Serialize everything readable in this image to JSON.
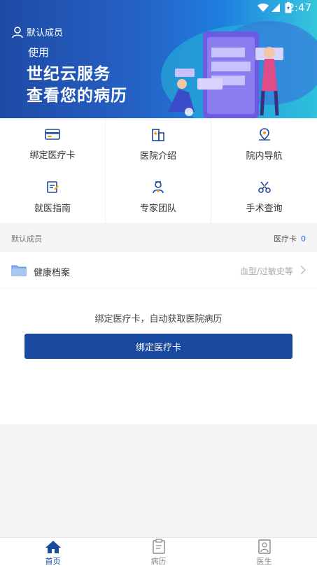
{
  "status": {
    "time": "2:47"
  },
  "banner": {
    "member": "默认成员",
    "slogan_small": "使用",
    "slogan_line1": "世纪云服务",
    "slogan_line2": "查看您的病历"
  },
  "grid": [
    {
      "label": "绑定医疗卡",
      "icon": "card-icon"
    },
    {
      "label": "医院介绍",
      "icon": "hospital-icon"
    },
    {
      "label": "院内导航",
      "icon": "location-icon"
    },
    {
      "label": "就医指南",
      "icon": "guide-icon"
    },
    {
      "label": "专家团队",
      "icon": "doctor-icon"
    },
    {
      "label": "手术查询",
      "icon": "scissors-icon"
    }
  ],
  "section": {
    "member_label": "默认成员",
    "card_label": "医疗卡",
    "card_count": "0"
  },
  "health": {
    "title": "健康档案",
    "hint": "血型/过敏史等"
  },
  "bind": {
    "message": "绑定医疗卡，自动获取医院病历",
    "button": "绑定医疗卡"
  },
  "nav": [
    {
      "label": "首页",
      "icon": "home-icon"
    },
    {
      "label": "病历",
      "icon": "record-icon"
    },
    {
      "label": "医生",
      "icon": "doctor-profile-icon"
    }
  ],
  "colors": {
    "primary": "#1a4a9f",
    "accent": "#1a5ad9",
    "banner_from": "#1f4aa6",
    "banner_to": "#35c6dd"
  }
}
